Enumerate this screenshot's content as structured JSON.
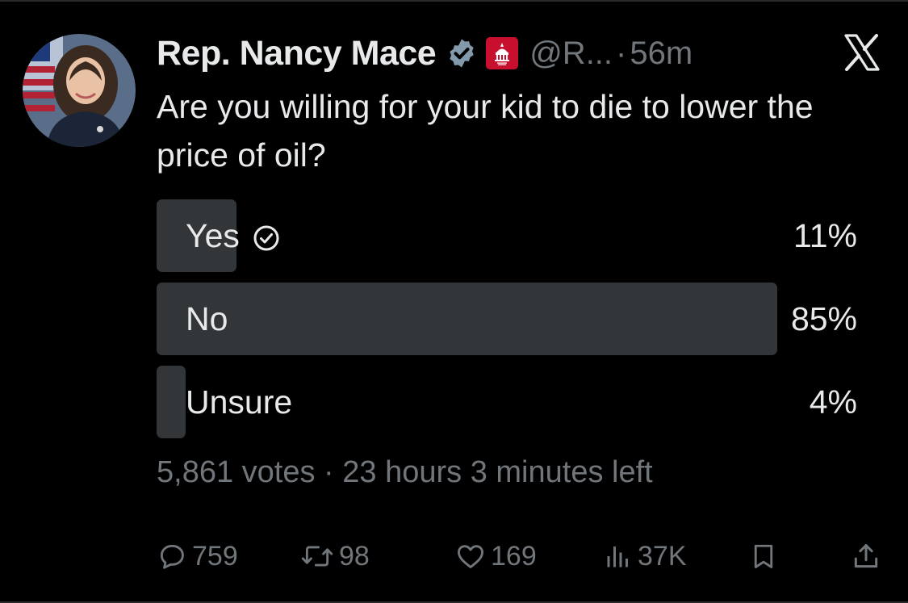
{
  "author": {
    "name": "Rep. Nancy Mace",
    "handle": "@R...",
    "separator": "·",
    "time": "56m"
  },
  "tweet": {
    "text": "Are you willing for your kid to die to lower the price of oil?"
  },
  "poll": {
    "options": [
      {
        "label": "Yes",
        "percent_text": "11%",
        "percent": 11,
        "selected": true
      },
      {
        "label": "No",
        "percent_text": "85%",
        "percent": 85,
        "selected": false
      },
      {
        "label": "Unsure",
        "percent_text": "4%",
        "percent": 4,
        "selected": false
      }
    ],
    "votes": "5,861 votes",
    "separator": "·",
    "time_left": "23 hours 3 minutes left"
  },
  "actions": {
    "replies": "759",
    "reposts": "98",
    "likes": "169",
    "views": "37K"
  },
  "colors": {
    "background": "#000000",
    "text": "#e7e9ea",
    "muted": "#71767b",
    "bar": "#333639",
    "verified": "#829aab",
    "affiliate": "#c8102e"
  },
  "icons": {
    "verified": "verified-badge-icon",
    "affiliate": "house-gop-badge-icon",
    "brand": "x-logo-icon",
    "check": "check-circle-icon",
    "reply": "reply-icon",
    "repost": "repost-icon",
    "like": "heart-icon",
    "views": "views-icon",
    "bookmark": "bookmark-icon",
    "share": "share-icon"
  }
}
